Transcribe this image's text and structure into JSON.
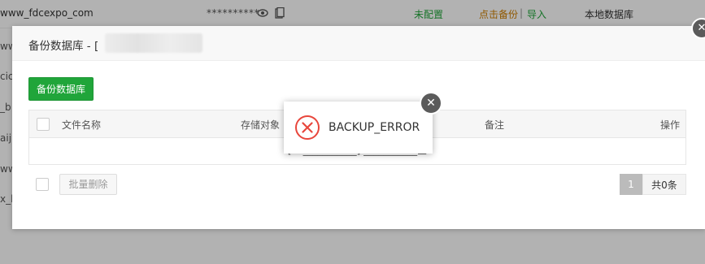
{
  "background": {
    "row1": {
      "name": "www_fdcexpo_com",
      "password": "**********",
      "eye_icon": "eye-icon",
      "copy_icon": "copy-icon",
      "status": "未配置",
      "backup": "点击备份",
      "separator": "|",
      "import": "导入",
      "type": "本地数据库"
    },
    "side_fragments": [
      "ww",
      "cico",
      "_b",
      "aiji",
      "ww",
      "x_l"
    ]
  },
  "modal": {
    "title": "备份数据库 - [",
    "close_icon": "close-icon",
    "backup_button": "备份数据库",
    "table": {
      "headers": [
        "文件名称",
        "存储对象",
        "备注",
        "操作"
      ],
      "empty_row": "[ch___________] ___________空"
    },
    "batch_delete": "批量删除",
    "pagination": {
      "page": "1",
      "total": "共0条"
    }
  },
  "error_popup": {
    "message": "BACKUP_ERROR",
    "icon": "error-circle-icon",
    "close_icon": "close-icon"
  },
  "colors": {
    "accent_green": "#20a53a",
    "backup_orange": "#cf7f00",
    "error_red": "#e8463c"
  }
}
